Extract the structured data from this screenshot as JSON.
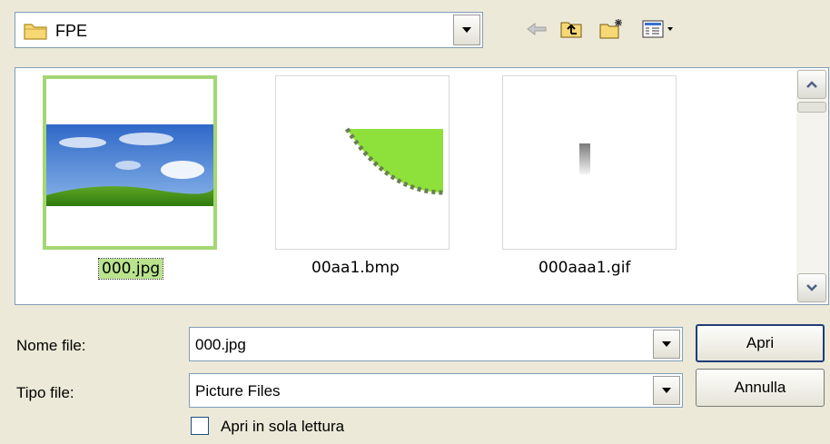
{
  "lookin": {
    "folder": "FPE",
    "icon": "folder-icon",
    "dropdown_icon": "chevron-down-icon"
  },
  "toolbar": [
    {
      "name": "back-button",
      "icon": "back-arrow-icon"
    },
    {
      "name": "up-folder-button",
      "icon": "folder-up-icon"
    },
    {
      "name": "new-folder-button",
      "icon": "new-folder-icon"
    },
    {
      "name": "view-menu-button",
      "icon": "view-menu-icon"
    }
  ],
  "files": [
    {
      "name": "000.jpg",
      "selected": true
    },
    {
      "name": "00aa1.bmp",
      "selected": false
    },
    {
      "name": "000aaa1.gif",
      "selected": false
    }
  ],
  "form": {
    "filename_label": "Nome file:",
    "filename_value": "000.jpg",
    "filetype_label": "Tipo file:",
    "filetype_value": "Picture Files",
    "open_label": "Apri",
    "cancel_label": "Annulla",
    "readonly_label": "Apri in sola lettura",
    "readonly_checked": false
  },
  "colors": {
    "selection": "#a4d774",
    "background": "#ece9d8",
    "border": "#7f9db9"
  }
}
